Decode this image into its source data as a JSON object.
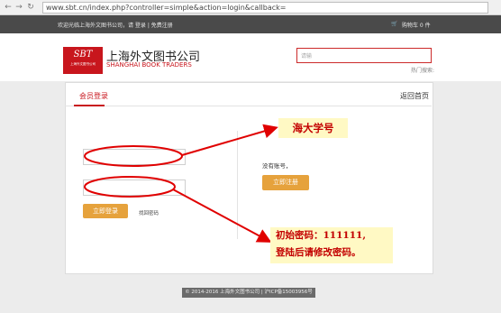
{
  "browser": {
    "url": "www.sbt.cn/index.php?controller=simple&action=login&callback="
  },
  "topbar": {
    "welcome": "欢迎光临上海外文图书公司，请 登录 | 免费注册",
    "cart": "购物车 0 件"
  },
  "header": {
    "logo_mark": "SBT",
    "logo_sub": "上海外文图书公司",
    "brand_cn": "上海外文图书公司",
    "brand_en": "SHANGHAI BOOK TRADERS",
    "search_placeholder": "请输",
    "hot_search": "热门搜索:"
  },
  "panel": {
    "tab_login": "会员登录",
    "back_home": "返回首页",
    "login_button": "立即登录",
    "forgot_password": "找回密码",
    "no_account": "没有账号，",
    "register_button": "立即注册"
  },
  "annotations": {
    "username_hint": "海大学号",
    "password_hint_line1": "初始密码：111111,",
    "password_hint_line2": "登陆后请修改密码。"
  },
  "footer": {
    "copyright": "© 2014-2016 上海外文图书公司 | 沪ICP备15003956号"
  },
  "colors": {
    "brand_red": "#c8161d",
    "button_orange": "#e6a23c",
    "annotation_red": "#e00000",
    "callout_bg": "#fff9c4"
  }
}
